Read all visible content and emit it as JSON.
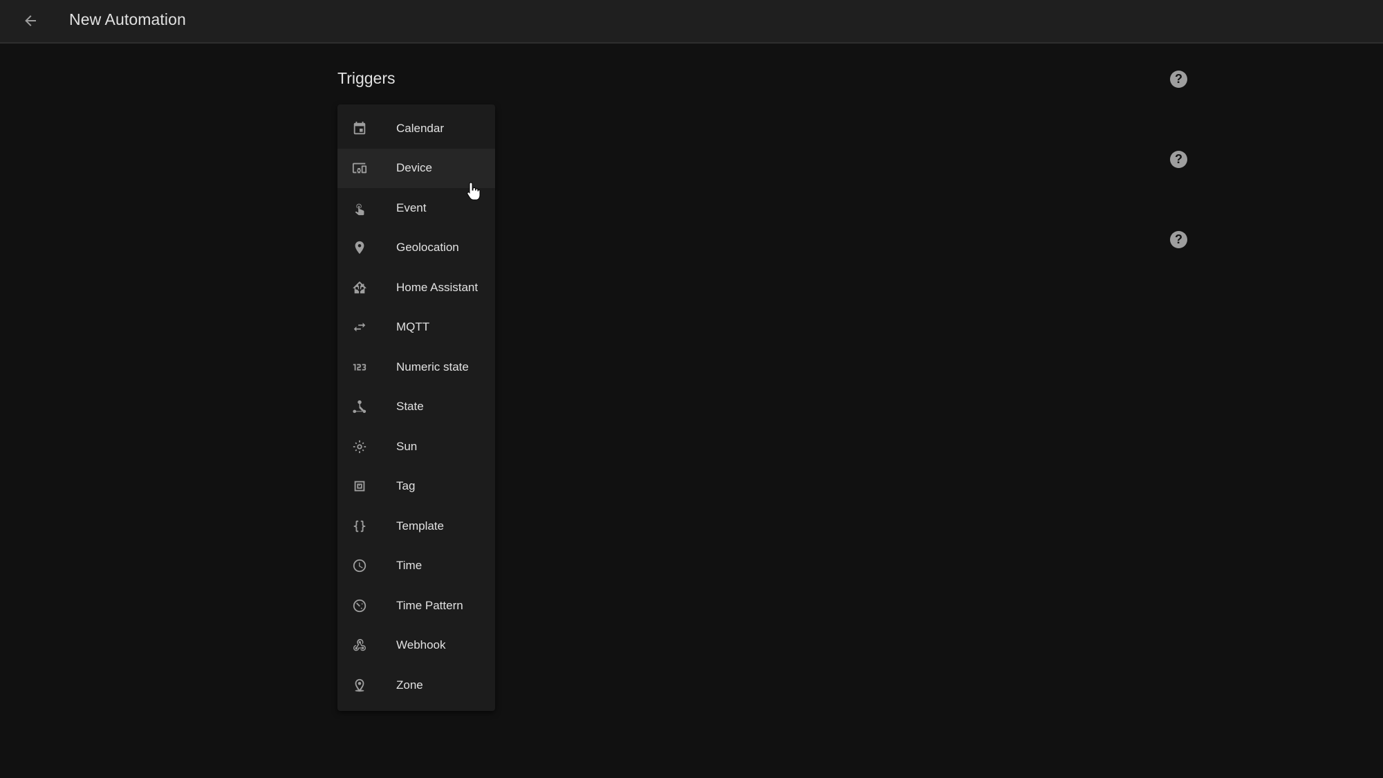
{
  "header": {
    "back_icon": "arrow-left-icon",
    "title": "New Automation"
  },
  "section": {
    "title": "Triggers"
  },
  "trigger_menu": {
    "hovered_index": 1,
    "items": [
      {
        "label": "Calendar",
        "icon": "calendar-icon"
      },
      {
        "label": "Device",
        "icon": "devices-icon"
      },
      {
        "label": "Event",
        "icon": "gesture-tap-icon"
      },
      {
        "label": "Geolocation",
        "icon": "map-marker-icon"
      },
      {
        "label": "Home Assistant",
        "icon": "home-assistant-icon"
      },
      {
        "label": "MQTT",
        "icon": "swap-horizontal-icon"
      },
      {
        "label": "Numeric state",
        "icon": "numeric-icon"
      },
      {
        "label": "State",
        "icon": "state-machine-icon"
      },
      {
        "label": "Sun",
        "icon": "sun-icon"
      },
      {
        "label": "Tag",
        "icon": "nfc-tag-icon"
      },
      {
        "label": "Template",
        "icon": "code-braces-icon"
      },
      {
        "label": "Time",
        "icon": "clock-icon"
      },
      {
        "label": "Time Pattern",
        "icon": "clock-pattern-icon"
      },
      {
        "label": "Webhook",
        "icon": "webhook-icon"
      },
      {
        "label": "Zone",
        "icon": "zone-marker-icon"
      }
    ]
  },
  "help_buttons": [
    {
      "icon": "help-circle-icon",
      "glyph": "?"
    },
    {
      "icon": "help-circle-icon",
      "glyph": "?"
    },
    {
      "icon": "help-circle-icon",
      "glyph": "?"
    }
  ]
}
